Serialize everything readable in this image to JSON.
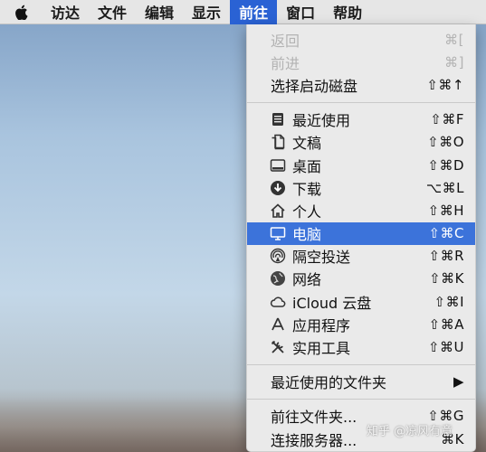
{
  "menubar": {
    "items": [
      "访达",
      "文件",
      "编辑",
      "显示",
      "前往",
      "窗口",
      "帮助"
    ],
    "active_index": 4
  },
  "go_menu": {
    "group1": [
      {
        "label": "返回",
        "shortcut": "⌘[",
        "disabled": true
      },
      {
        "label": "前进",
        "shortcut": "⌘]",
        "disabled": true
      },
      {
        "label": "选择启动磁盘",
        "shortcut": "⇧⌘↑",
        "disabled": false
      }
    ],
    "group2": [
      {
        "label": "最近使用",
        "shortcut": "⇧⌘F",
        "icon": "recents-icon"
      },
      {
        "label": "文稿",
        "shortcut": "⇧⌘O",
        "icon": "documents-icon"
      },
      {
        "label": "桌面",
        "shortcut": "⇧⌘D",
        "icon": "desktop-icon"
      },
      {
        "label": "下载",
        "shortcut": "⌥⌘L",
        "icon": "downloads-icon"
      },
      {
        "label": "个人",
        "shortcut": "⇧⌘H",
        "icon": "home-icon"
      },
      {
        "label": "电脑",
        "shortcut": "⇧⌘C",
        "icon": "computer-icon",
        "highlighted": true
      },
      {
        "label": "隔空投送",
        "shortcut": "⇧⌘R",
        "icon": "airdrop-icon"
      },
      {
        "label": "网络",
        "shortcut": "⇧⌘K",
        "icon": "network-icon"
      },
      {
        "label": "iCloud 云盘",
        "shortcut": "⇧⌘I",
        "icon": "icloud-icon"
      },
      {
        "label": "应用程序",
        "shortcut": "⇧⌘A",
        "icon": "applications-icon"
      },
      {
        "label": "实用工具",
        "shortcut": "⇧⌘U",
        "icon": "utilities-icon"
      }
    ],
    "group3": [
      {
        "label": "最近使用的文件夹",
        "shortcut": "▶"
      }
    ],
    "group4": [
      {
        "label": "前往文件夹...",
        "shortcut": "⇧⌘G"
      },
      {
        "label": "连接服务器...",
        "shortcut": "⌘K"
      }
    ]
  },
  "watermark": "知乎 @凉风有意",
  "colors": {
    "menubar_bg": "#e6e6e6",
    "active_menu": "#2a62d4",
    "highlight_row": "#3c73da",
    "disabled_text": "#b3b3b3"
  }
}
